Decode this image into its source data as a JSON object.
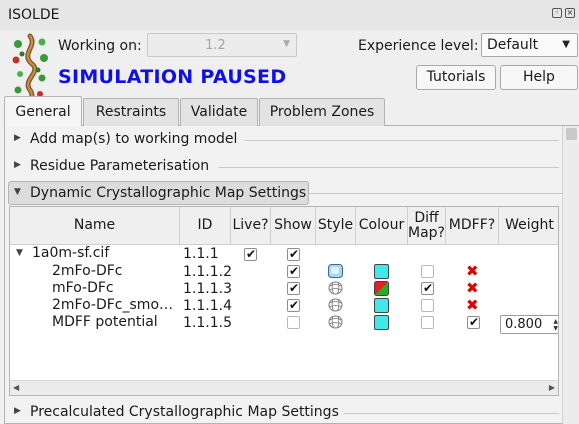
{
  "window": {
    "title": "ISOLDE"
  },
  "header": {
    "working_on_label": "Working on:",
    "working_on_value": "1.2",
    "experience_label": "Experience level:",
    "experience_value": "Default",
    "status": "SIMULATION PAUSED",
    "tutorials_label": "Tutorials",
    "help_label": "Help"
  },
  "tabs": [
    {
      "label": "General",
      "active": true
    },
    {
      "label": "Restraints",
      "active": false
    },
    {
      "label": "Validate",
      "active": false
    },
    {
      "label": "Problem Zones",
      "active": false
    }
  ],
  "sections": {
    "add_map": "Add map(s) to working model",
    "residue_param": "Residue Parameterisation",
    "dynamic_maps": "Dynamic Crystallographic Map Settings",
    "precalc_maps": "Precalculated Crystallographic Map Settings"
  },
  "table": {
    "headers": {
      "name": "Name",
      "id": "ID",
      "live": "Live?",
      "show": "Show",
      "style": "Style",
      "colour": "Colour",
      "diff_line1": "Diff",
      "diff_line2": "Map?",
      "mdff": "MDFF?",
      "weight": "Weight"
    },
    "rows": [
      {
        "name": "1a0m-sf.cif",
        "id": "1.1.1",
        "live": true,
        "show": true
      },
      {
        "name": "2mFo-DFc",
        "id": "1.1.1.2",
        "show": true,
        "style": "mesh",
        "colour": "#40e8e8",
        "diff": false,
        "mdff": "x"
      },
      {
        "name": "mFo-DFc",
        "id": "1.1.1.3",
        "show": true,
        "style": "mesh",
        "colour": "diff",
        "diff": true,
        "mdff": "x"
      },
      {
        "name": "2mFo-DFc_smo…",
        "id": "1.1.1.4",
        "show": true,
        "style": "mesh",
        "colour": "#40e8e8",
        "diff": false,
        "mdff": "x"
      },
      {
        "name": "MDFF potential",
        "id": "1.1.1.5",
        "show": false,
        "style": "mesh",
        "colour": "#40e8e8",
        "diff": false,
        "mdff": "check",
        "weight": "0.800"
      }
    ],
    "colors": {
      "cyan": "#40e8e8",
      "diff_red": "#e62020",
      "diff_green": "#20b020",
      "mdff_x": "#e00000"
    }
  }
}
